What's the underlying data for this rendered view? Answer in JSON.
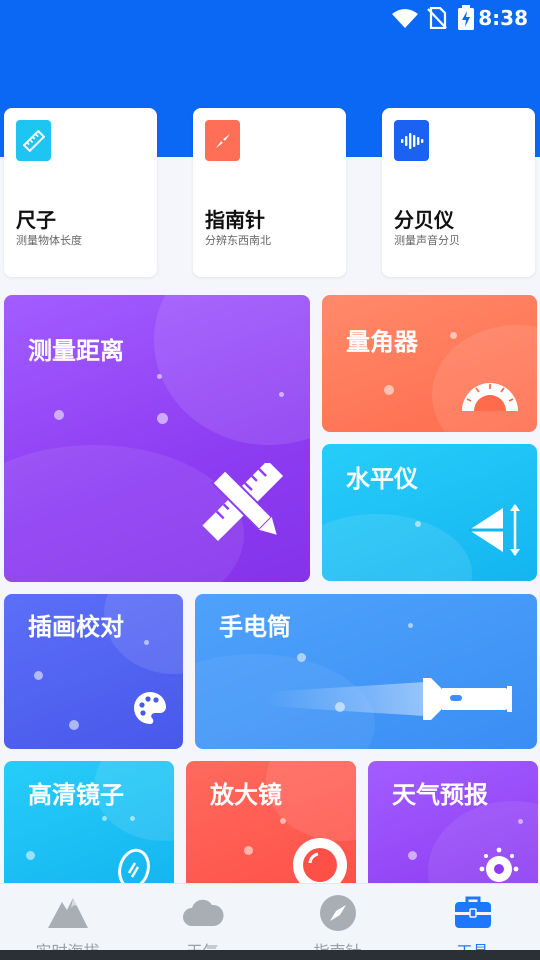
{
  "status": {
    "time": "8:38"
  },
  "top_cards": [
    {
      "title": "尺子",
      "subtitle": "测量物体长度",
      "icon": "ruler-icon",
      "color": "#1ec4f2"
    },
    {
      "title": "指南针",
      "subtitle": "分辨东西南北",
      "icon": "compass-icon",
      "color": "#ff6e56"
    },
    {
      "title": "分贝仪",
      "subtitle": "测量声音分贝",
      "icon": "sound-wave-icon",
      "color": "#1c62f2"
    }
  ],
  "tiles": {
    "measure_distance": "测量距离",
    "protractor": "量角器",
    "level": "水平仪",
    "illustration_check": "插画校对",
    "flashlight": "手电筒",
    "hd_mirror": "高清镜子",
    "magnifier": "放大镜",
    "weather_forecast": "天气预报"
  },
  "tabbar": [
    {
      "label": "实时海拔",
      "icon": "mountain-icon"
    },
    {
      "label": "天气",
      "icon": "cloud-icon"
    },
    {
      "label": "指南针",
      "icon": "compass-icon"
    },
    {
      "label": "工具",
      "icon": "toolbox-icon",
      "active": true
    }
  ]
}
